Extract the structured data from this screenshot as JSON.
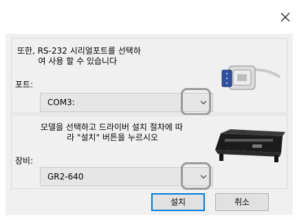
{
  "dialog": {
    "close_glyph": "×"
  },
  "port_section": {
    "description": "또한, RS-232 시리얼포트를 선택하\n        여 사용 할 수 있습니다",
    "label": "포트:",
    "selected": "COM3:",
    "image_icon": "serial-connector-image"
  },
  "device_section": {
    "description": "모델을 선택하고 드라이버 설치 절차에 따\n          라 \"설치\" 버튼을 누르시오",
    "label": "장비:",
    "selected": "GR2-640",
    "image_icon": "cutting-plotter-image"
  },
  "buttons": {
    "install": "설치",
    "cancel": "취소"
  },
  "colors": {
    "highlight": "#9a9a9a",
    "default_button_border": "#0078d7"
  }
}
